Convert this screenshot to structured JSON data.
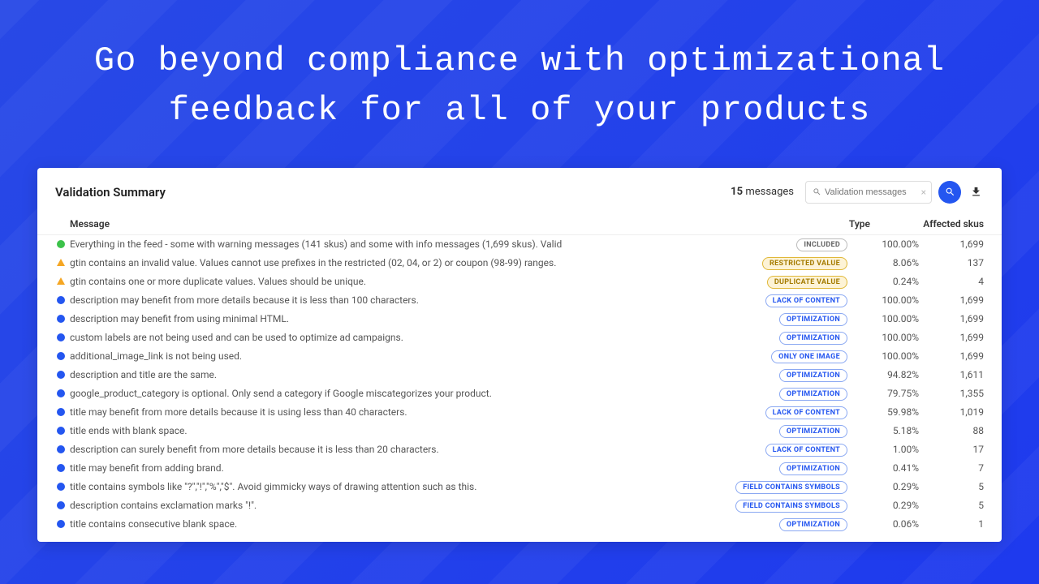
{
  "headline": "Go beyond compliance with optimizational feedback for all of your products",
  "panel": {
    "title": "Validation Summary",
    "message_count": "15",
    "message_count_label": "messages",
    "search_placeholder": "Validation messages"
  },
  "columns": {
    "message": "Message",
    "type": "Type",
    "skus": "Affected skus"
  },
  "badge_labels": {
    "included": "INCLUDED",
    "restricted": "RESTRICTED VALUE",
    "duplicate": "DUPLICATE VALUE",
    "lack": "LACK OF CONTENT",
    "opt": "OPTIMIZATION",
    "oneimg": "ONLY ONE IMAGE",
    "symbols": "FIELD CONTAINS SYMBOLS"
  },
  "rows": [
    {
      "icon": "ok",
      "msg": "Everything in the feed - some with warning messages (141 skus) and some with info messages (1,699 skus). Valid",
      "badge": "included",
      "pct": "100.00%",
      "skus": "1,699"
    },
    {
      "icon": "warn",
      "msg": "gtin contains an invalid value. Values cannot use prefixes in the restricted (02, 04, or 2) or coupon (98-99) ranges.",
      "badge": "restricted",
      "pct": "8.06%",
      "skus": "137"
    },
    {
      "icon": "warn",
      "msg": "gtin contains one or more duplicate values. Values should be unique.",
      "badge": "duplicate",
      "pct": "0.24%",
      "skus": "4"
    },
    {
      "icon": "info",
      "msg": "description may benefit from more details because it is less than 100 characters.",
      "badge": "lack",
      "pct": "100.00%",
      "skus": "1,699"
    },
    {
      "icon": "info",
      "msg": "description may benefit from using minimal HTML.",
      "badge": "opt",
      "pct": "100.00%",
      "skus": "1,699"
    },
    {
      "icon": "info",
      "msg": "custom labels are not being used and can be used to optimize ad campaigns.",
      "badge": "opt",
      "pct": "100.00%",
      "skus": "1,699"
    },
    {
      "icon": "info",
      "msg": "additional_image_link is not being used.",
      "badge": "oneimg",
      "pct": "100.00%",
      "skus": "1,699"
    },
    {
      "icon": "info",
      "msg": "description and title are the same.",
      "badge": "opt",
      "pct": "94.82%",
      "skus": "1,611"
    },
    {
      "icon": "info",
      "msg": "google_product_category is optional. Only send a category if Google miscategorizes your product.",
      "badge": "opt",
      "pct": "79.75%",
      "skus": "1,355"
    },
    {
      "icon": "info",
      "msg": "title may benefit from more details because it is using less than 40 characters.",
      "badge": "lack",
      "pct": "59.98%",
      "skus": "1,019"
    },
    {
      "icon": "info",
      "msg": "title ends with blank space.",
      "badge": "opt",
      "pct": "5.18%",
      "skus": "88"
    },
    {
      "icon": "info",
      "msg": "description can surely benefit from more details because it is less than 20 characters.",
      "badge": "lack",
      "pct": "1.00%",
      "skus": "17"
    },
    {
      "icon": "info",
      "msg": "title may benefit from adding brand.",
      "badge": "opt",
      "pct": "0.41%",
      "skus": "7"
    },
    {
      "icon": "info",
      "msg": "title contains symbols like \"?\",\"!\",\"%\",\"$\". Avoid gimmicky ways of drawing attention such as this.",
      "badge": "symbols",
      "pct": "0.29%",
      "skus": "5"
    },
    {
      "icon": "info",
      "msg": "description contains exclamation marks \"!\".",
      "badge": "symbols",
      "pct": "0.29%",
      "skus": "5"
    },
    {
      "icon": "info",
      "msg": "title contains consecutive blank space.",
      "badge": "opt",
      "pct": "0.06%",
      "skus": "1"
    }
  ]
}
